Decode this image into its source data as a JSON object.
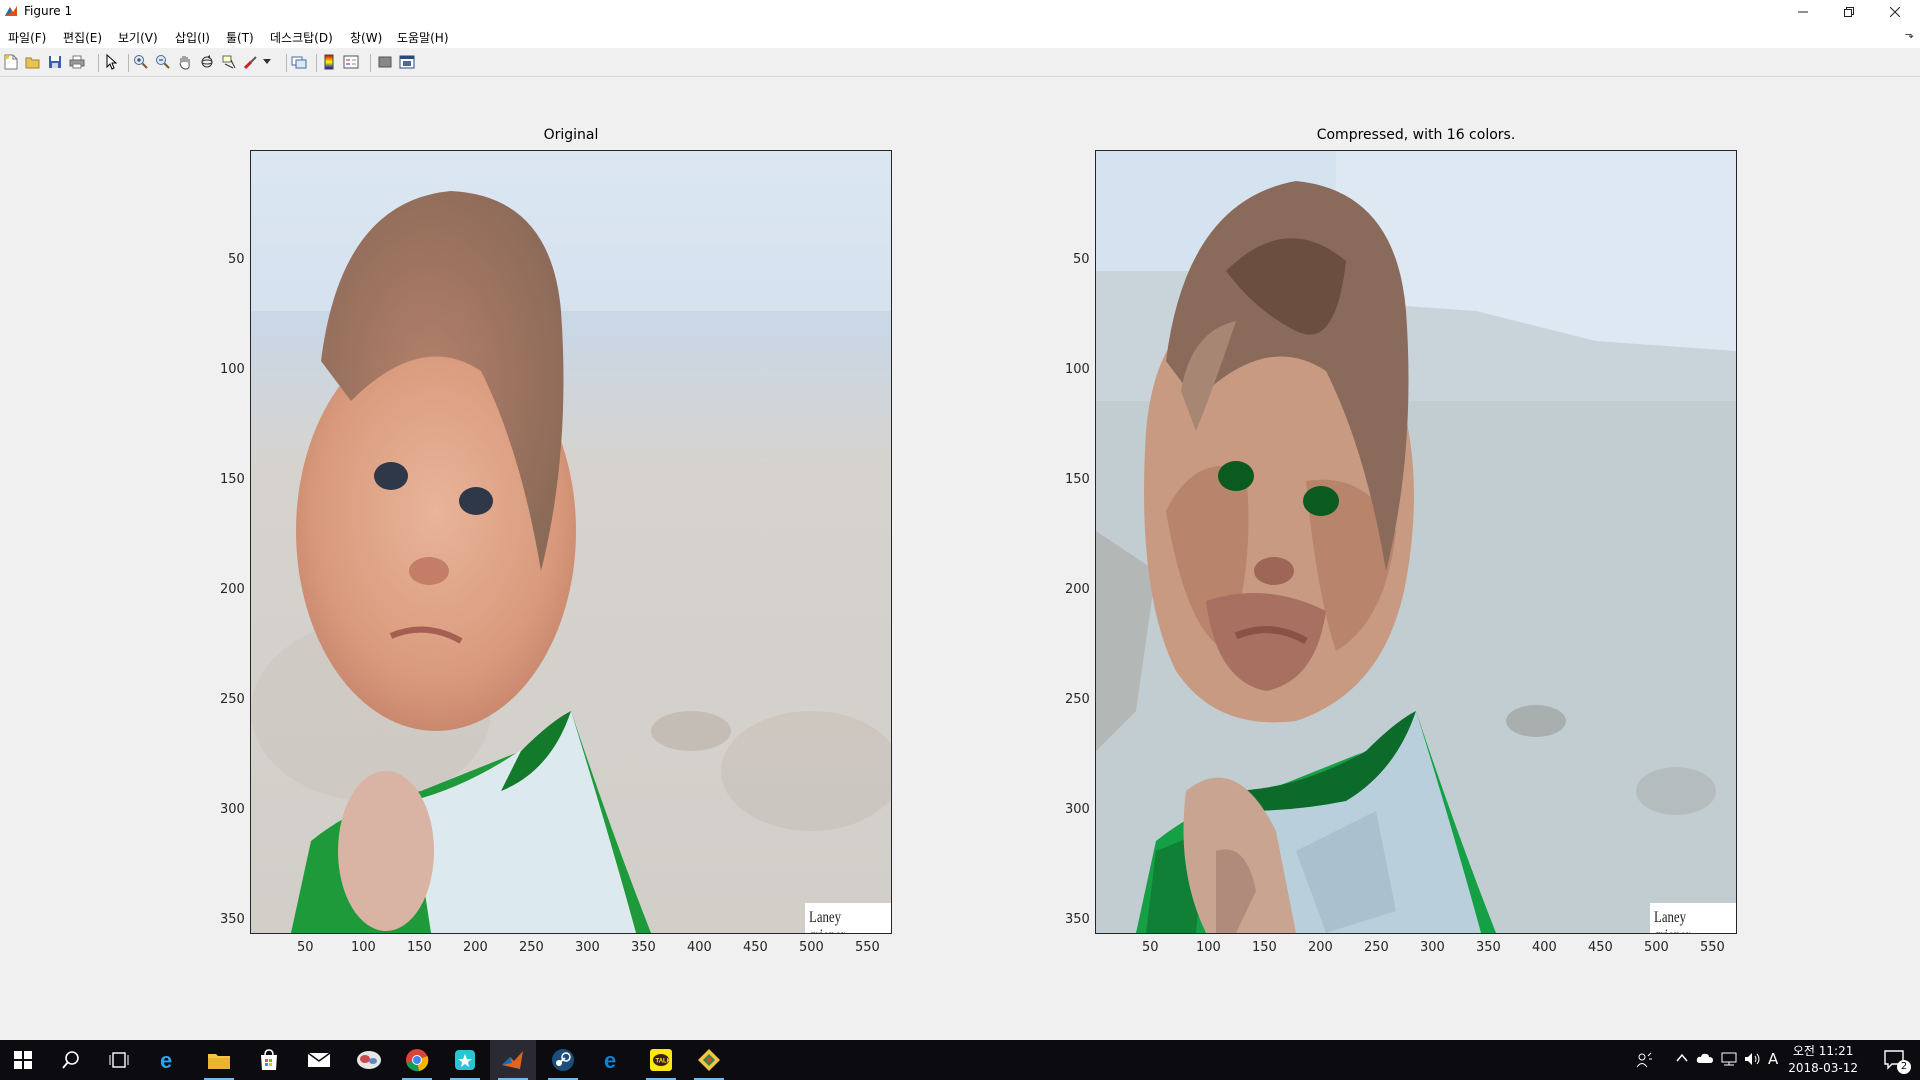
{
  "window": {
    "title": "Figure 1"
  },
  "menu": [
    "파일(F)",
    "편집(E)",
    "보기(V)",
    "삽입(I)",
    "툴(T)",
    "데스크탑(D)",
    "창(W)",
    "도움말(H)"
  ],
  "toolbar": [
    "new-figure-icon",
    "open-icon",
    "save-icon",
    "print-icon",
    "pointer-icon",
    "zoom-in-icon",
    "zoom-out-icon",
    "pan-icon",
    "rotate-icon",
    "data-cursor-icon",
    "brush-icon",
    "link-icon",
    "colorbar-icon",
    "legend-icon",
    "hide-plot-tools-icon",
    "show-plot-tools-icon"
  ],
  "plots": [
    {
      "title": "Original",
      "image": "baby photo: original colors",
      "watermark": "Laney griener",
      "x_ticks": [
        "50",
        "100",
        "150",
        "200",
        "250",
        "300",
        "350",
        "400",
        "450",
        "500",
        "550"
      ],
      "y_ticks": [
        "50",
        "100",
        "150",
        "200",
        "250",
        "300",
        "350"
      ]
    },
    {
      "title": "Compressed, with 16 colors.",
      "image": "baby photo: quantized to 16 colors",
      "watermark": "Laney griener",
      "x_ticks": [
        "50",
        "100",
        "150",
        "200",
        "250",
        "300",
        "350",
        "400",
        "450",
        "500",
        "550"
      ],
      "y_ticks": [
        "50",
        "100",
        "150",
        "200",
        "250",
        "300",
        "350"
      ]
    }
  ],
  "taskbar": {
    "apps": [
      "start-icon",
      "search-icon",
      "task-view-icon",
      "internet-explorer-icon",
      "file-explorer-icon",
      "store-icon",
      "mail-icon",
      "app-icon",
      "chrome-icon",
      "app-icon-2",
      "matlab-icon",
      "steam-icon",
      "edge-icon",
      "kakaotalk-icon",
      "app-icon-3"
    ],
    "ime": "A",
    "time": "오전 11:21",
    "date": "2018-03-12",
    "notification_count": "2"
  },
  "colors": {
    "axes_bg": "#f0f0f0",
    "taskbar": "#0b0b10",
    "accent": "#76b9ed"
  }
}
